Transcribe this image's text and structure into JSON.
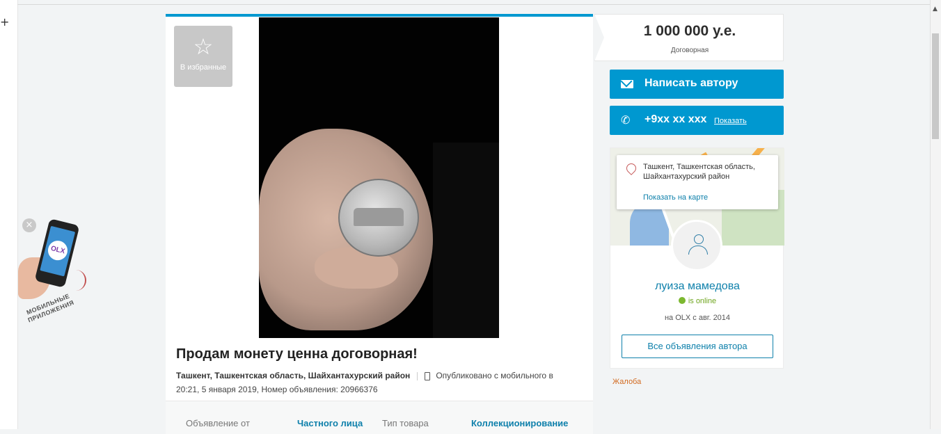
{
  "browser": {
    "new_tab_icon": "+",
    "scroll_up_icon": "▲"
  },
  "promo": {
    "close_icon": "×",
    "logo_text": "OLX",
    "text_line1": "МОБИЛЬНЫЕ",
    "text_line2": "ПРИЛОЖЕНИЯ"
  },
  "listing": {
    "favorite_icon": "☆",
    "favorite_label": "В избранные",
    "title": "Продам монету ценна договорная!",
    "location": "Ташкент, Ташкентская область, Шайхантахурский район",
    "published": "Опубликовано с мобильного",
    "published_tail": "в",
    "date_line": "20:21, 5 января 2019, Номер объявления: 20966376",
    "details": [
      {
        "label": "Объявление от",
        "value": "Частного лица"
      },
      {
        "label": "Тип товара",
        "value": "Коллекционирование"
      }
    ]
  },
  "price": {
    "value": "1 000 000 у.е.",
    "note": "Договорная"
  },
  "actions": {
    "message_label": "Написать автору",
    "phone_icon": "✆",
    "phone_number": "+9xx xx xxx",
    "phone_show": "Показать"
  },
  "seller": {
    "location": "Ташкент, Ташкентская область, Шайхантахурский район",
    "map_link": "Показать на карте",
    "name": "луиза мамедова",
    "online": "is online",
    "since": "на OLX с авг. 2014",
    "all_ads": "Все объявления автора"
  },
  "complaint": "Жалоба",
  "colors": {
    "accent": "#0098d0",
    "link": "#0e80ab",
    "online": "#7cb830"
  }
}
